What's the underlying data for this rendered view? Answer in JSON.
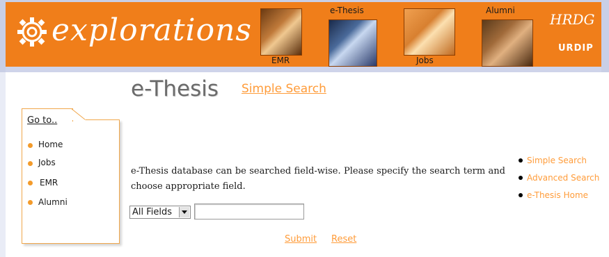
{
  "banner": {
    "logo_text": "explorations",
    "nav": [
      {
        "label": "EMR"
      },
      {
        "label": "e-Thesis"
      },
      {
        "label": "Jobs"
      },
      {
        "label": "Alumni"
      }
    ],
    "hrdg": "HRDG",
    "urdip": "URDIP"
  },
  "header": {
    "title": "e-Thesis",
    "link": "Simple Search"
  },
  "goto": {
    "title": "Go to..",
    "items": [
      "Home",
      "Jobs",
      "EMR",
      "Alumni"
    ]
  },
  "main": {
    "intro": "e-Thesis database can be searched field-wise. Please specify the search term and choose appropriate field.",
    "field_select": "All Fields",
    "search_value": "",
    "submit_label": "Submit",
    "reset_label": "Reset"
  },
  "side_links": [
    "Simple Search",
    "Advanced Search",
    "e-Thesis Home"
  ],
  "colors": {
    "banner": "#f07e1a",
    "link": "#ff9c3a",
    "bullet": "#f39b2b"
  }
}
